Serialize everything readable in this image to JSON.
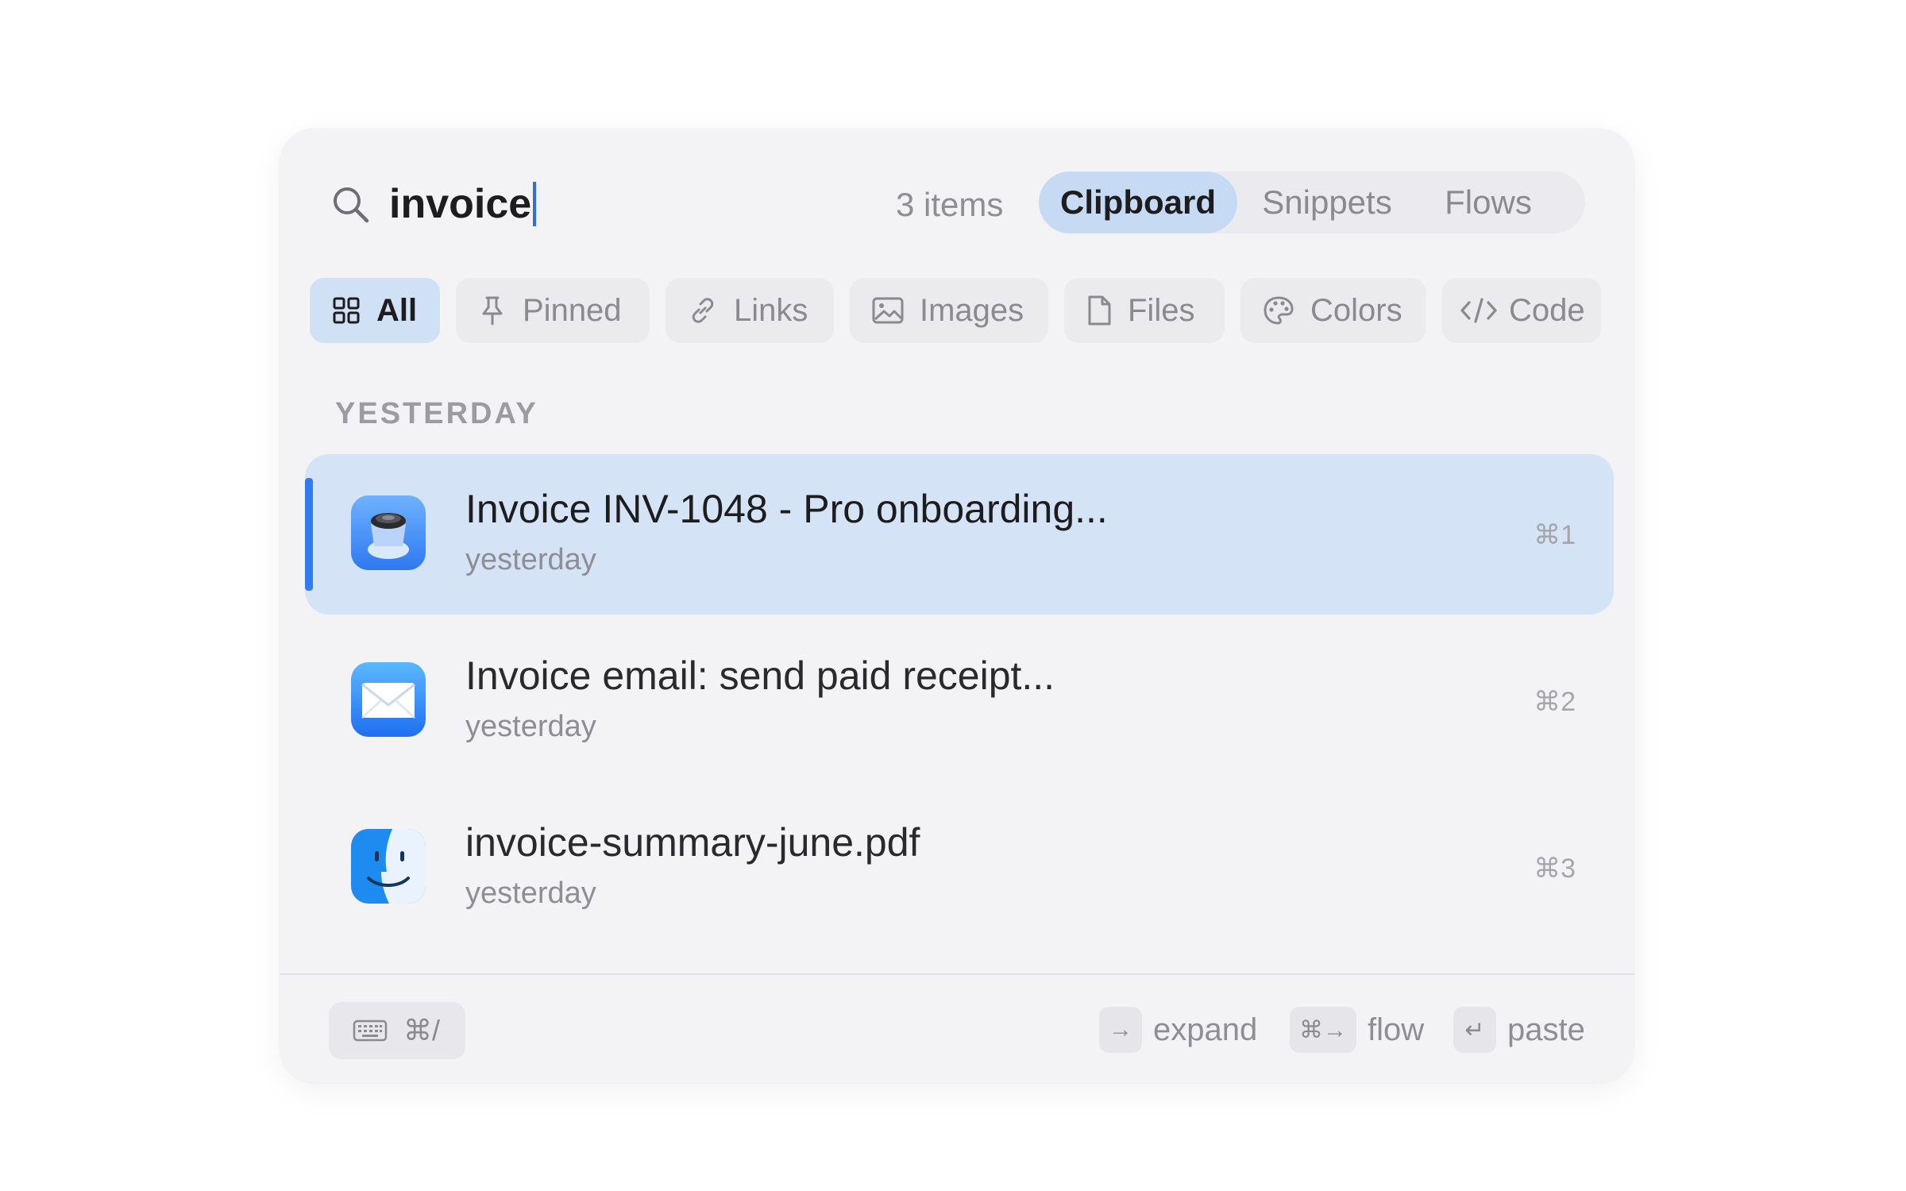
{
  "search": {
    "query": "invoice",
    "count": "3 items"
  },
  "tabs": [
    {
      "label": "Clipboard",
      "active": true
    },
    {
      "label": "Snippets",
      "active": false
    },
    {
      "label": "Flows",
      "active": false
    }
  ],
  "filters": [
    {
      "label": "All",
      "icon": "grid-icon",
      "active": true
    },
    {
      "label": "Pinned",
      "icon": "pin-icon",
      "active": false
    },
    {
      "label": "Links",
      "icon": "link-icon",
      "active": false
    },
    {
      "label": "Images",
      "icon": "image-icon",
      "active": false
    },
    {
      "label": "Files",
      "icon": "file-icon",
      "active": false
    },
    {
      "label": "Colors",
      "icon": "palette-icon",
      "active": false
    },
    {
      "label": "Code",
      "icon": "code-icon",
      "active": false
    }
  ],
  "section": {
    "label": "YESTERDAY"
  },
  "items": [
    {
      "title": "Invoice INV-1048 - Pro onboarding...",
      "time": "yesterday",
      "shortcut": "⌘1",
      "app_icon": "preview-app-icon",
      "selected": true
    },
    {
      "title": "Invoice email: send paid receipt...",
      "time": "yesterday",
      "shortcut": "⌘2",
      "app_icon": "mail-app-icon",
      "selected": false
    },
    {
      "title": "invoice-summary-june.pdf",
      "time": "yesterday",
      "shortcut": "⌘3",
      "app_icon": "finder-app-icon",
      "selected": false
    }
  ],
  "footer": {
    "shortcut": "⌘/",
    "hints": [
      {
        "key": "→",
        "label": "expand"
      },
      {
        "key": "⌘→",
        "label": "flow"
      },
      {
        "key": "↵",
        "label": "paste"
      }
    ]
  },
  "colors": {
    "accent": "#2f7cf0",
    "selected_row": "#d4e3f5",
    "active_tab": "#c6daf4",
    "panel": "#f3f3f6"
  }
}
